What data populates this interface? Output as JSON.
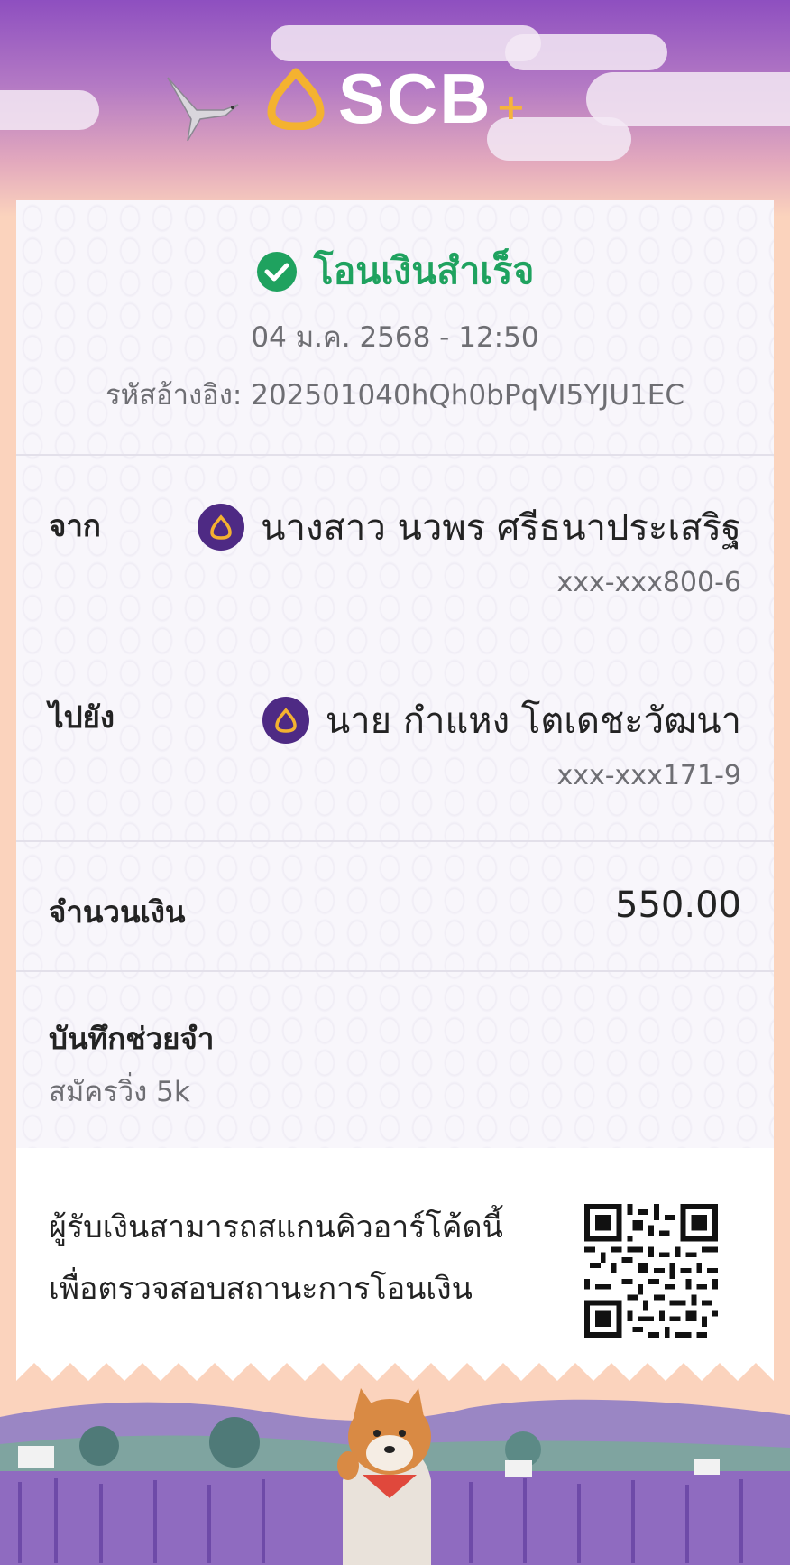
{
  "header": {
    "brand_name": "SCB",
    "brand_plus": "+"
  },
  "receipt": {
    "status": "โอนเงินสำเร็จ",
    "datetime": "04 ม.ค. 2568 - 12:50",
    "reference": "รหัสอ้างอิง: 202501040hQh0bPqVI5YJU1EC",
    "from": {
      "label": "จาก",
      "name": "นางสาว นวพร ศรีธนาประเสริฐ",
      "account": "xxx-xxx800-6"
    },
    "to": {
      "label": "ไปยัง",
      "name": "นาย กำแหง โตเดชะวัฒนา",
      "account": "xxx-xxx171-9"
    },
    "amount": {
      "label": "จำนวนเงิน",
      "value": "550.00"
    },
    "memo": {
      "label": "บันทึกช่วยจำ",
      "value": "สมัครวิ่ง 5k"
    },
    "qr_note": {
      "line1": "ผู้รับเงินสามารถสแกนคิวอาร์โค้ดนี้",
      "line2": "เพื่อตรวจสอบสถานะการโอนเงิน"
    }
  },
  "colors": {
    "success": "#1fa25f",
    "brand_purple": "#4e2a84",
    "brand_gold": "#f6b43a"
  },
  "icons": [
    "scb-logo-icon",
    "bird-icon",
    "check-circle-icon",
    "scb-bank-icon",
    "qr-code-icon",
    "shiba-dog-icon"
  ]
}
